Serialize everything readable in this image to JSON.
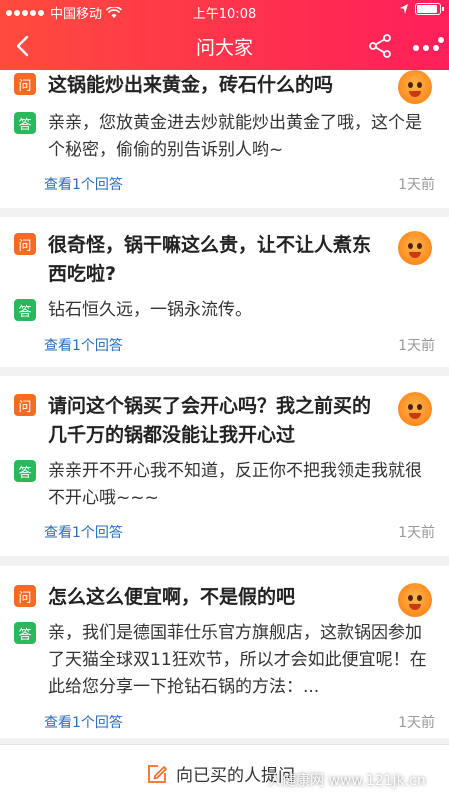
{
  "status_bar": {
    "carrier": "中国移动",
    "time": "上午10:08"
  },
  "header": {
    "title": "问大家",
    "back_icon": "chevron-left-icon",
    "share_icon": "share-icon",
    "more_icon": "more-dots-icon"
  },
  "colors": {
    "header_gradient_start": "#ff4a3d",
    "header_gradient_end": "#ff1f5a",
    "question_badge": "#f56b23",
    "answer_badge": "#2ab85c",
    "link": "#2a6eb8"
  },
  "badges": {
    "question": "问",
    "answer": "答"
  },
  "questions": [
    {
      "question": "这锅能炒出来黄金，砖石什么的吗",
      "answer": "亲亲，您放黄金进去炒就能炒出黄金了哦，这个是个秘密，偷偷的别告诉别人哟~",
      "answers_link": "查看1个回答",
      "time": "1天前"
    },
    {
      "question": "很奇怪，锅干嘛这么贵，让不让人煮东西吃啦?",
      "answer": "钻石恒久远，一锅永流传。",
      "answers_link": "查看1个回答",
      "time": "1天前"
    },
    {
      "question": "请问这个锅买了会开心吗？我之前买的几千万的锅都没能让我开心过",
      "answer": "亲亲开不开心我不知道，反正你不把我领走我就很不开心哦~~~",
      "answers_link": "查看1个回答",
      "time": "1天前"
    },
    {
      "question": "怎么这么便宜啊，不是假的吧",
      "answer": "亲，我们是德国菲仕乐官方旗舰店，这款锅因参加了天猫全球双11狂欢节，所以才会如此便宜呢！在此给您分享一下抢钻石锅的方法：...",
      "answers_link": "查看1个回答",
      "time": "1天前"
    }
  ],
  "bottom_bar": {
    "ask_label": "向已买的人提问",
    "ask_icon": "edit-icon"
  },
  "watermark": "人健康网 www.121jk.cn"
}
